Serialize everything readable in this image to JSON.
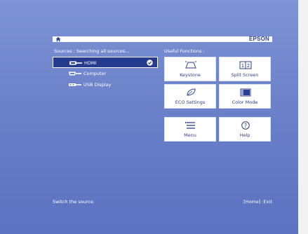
{
  "header": {
    "home_icon": "home-icon",
    "brand": "EPSON"
  },
  "sources": {
    "title": "Sources : Searching all sources...",
    "items": [
      {
        "label": "HDMI",
        "icon": "hdmi-connector-icon",
        "selected": true
      },
      {
        "label": "Computer",
        "icon": "vga-connector-icon",
        "selected": false
      },
      {
        "label": "USB Display",
        "icon": "usb-connector-icon",
        "selected": false
      }
    ]
  },
  "functions": {
    "title": "Useful Functions :",
    "items": [
      {
        "label": "Keystone",
        "icon": "keystone-icon"
      },
      {
        "label": "Split Screen",
        "icon": "split-screen-icon"
      },
      {
        "label": "ECO Settings",
        "icon": "eco-leaf-icon"
      },
      {
        "label": "Color Mode",
        "icon": "color-mode-icon"
      },
      {
        "label": "Menu",
        "icon": "menu-icon"
      },
      {
        "label": "Help",
        "icon": "help-icon"
      }
    ]
  },
  "status": {
    "hint": "Switch the source.",
    "exit": "[Home] :Exit"
  },
  "colors": {
    "background": "#6b81c9",
    "selected": "#253b8d",
    "brand": "#2b3f8f",
    "button": "#ffffff"
  }
}
